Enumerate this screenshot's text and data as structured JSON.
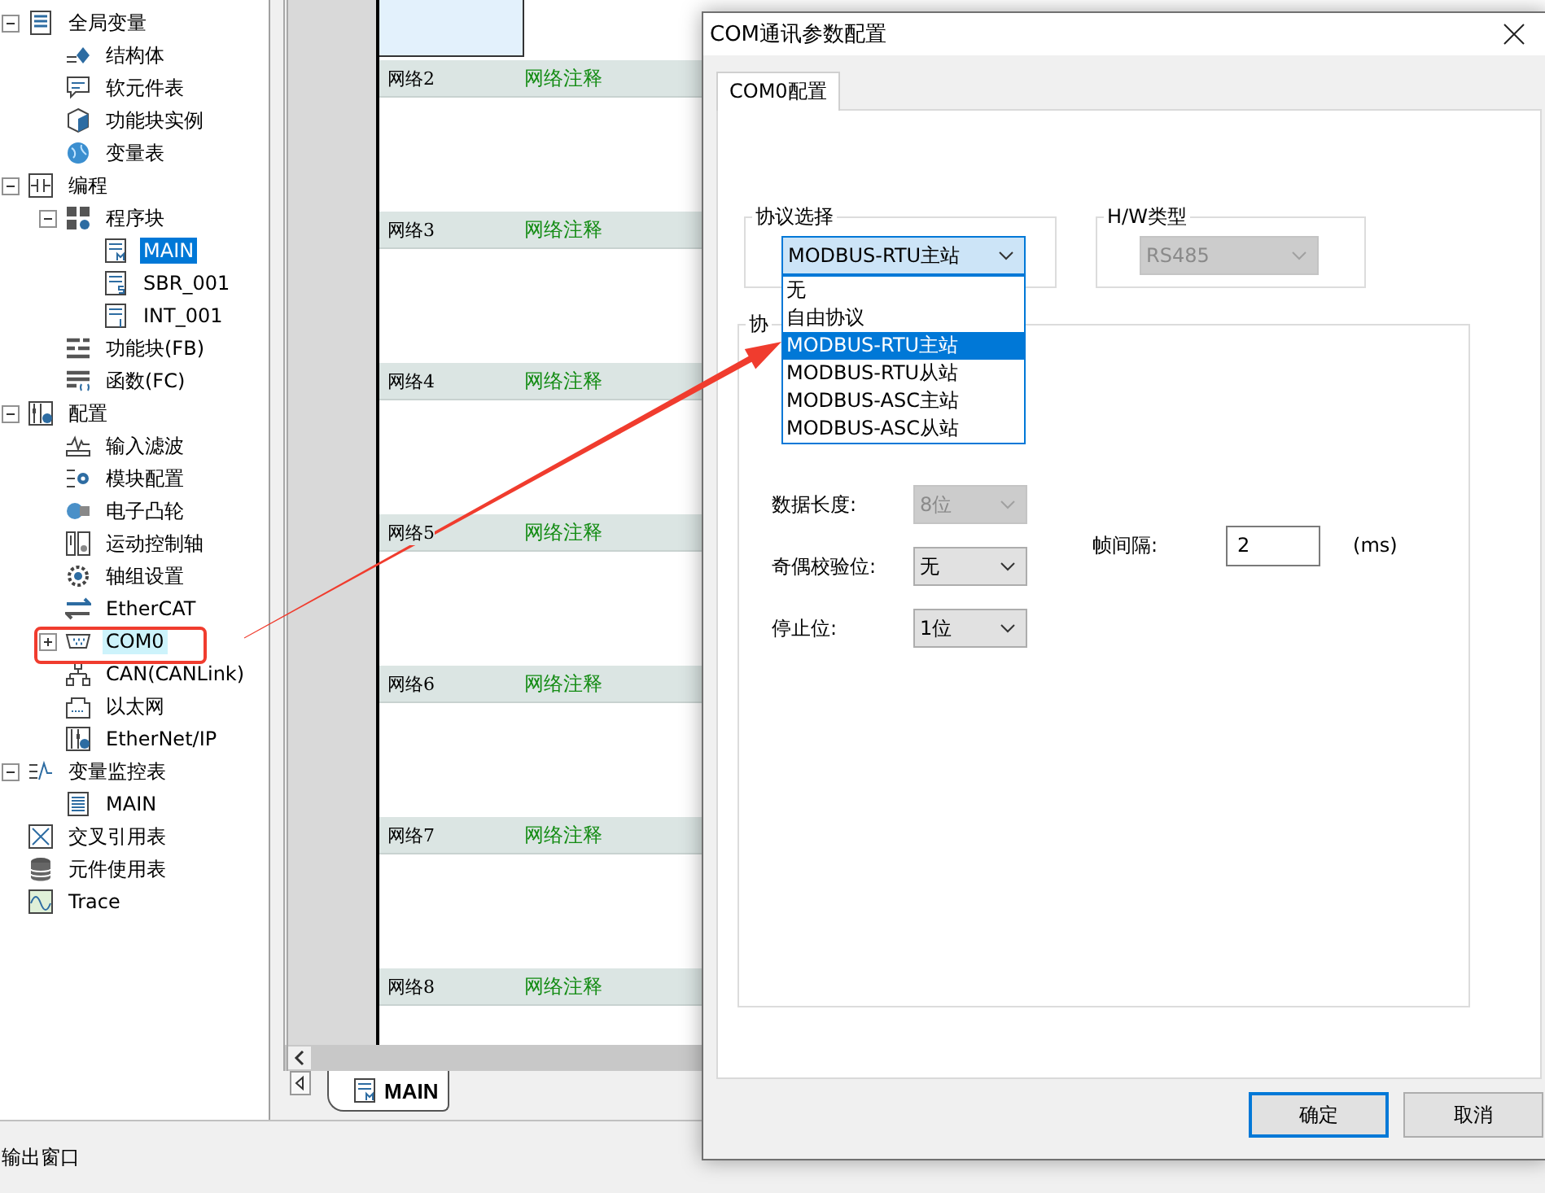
{
  "tree": [
    {
      "label": "全局变量",
      "expanded": true,
      "selected": false,
      "highlighted": false,
      "children": [
        {
          "label": "结构体",
          "selected": false,
          "highlighted": false
        },
        {
          "label": "软元件表",
          "selected": false,
          "highlighted": false
        },
        {
          "label": "功能块实例",
          "selected": false,
          "highlighted": false
        },
        {
          "label": "变量表",
          "selected": false,
          "highlighted": false
        }
      ]
    },
    {
      "label": "编程",
      "expanded": true,
      "selected": false,
      "highlighted": false,
      "children": [
        {
          "label": "程序块",
          "expanded": true,
          "selected": false,
          "highlighted": false,
          "children": [
            {
              "label": "MAIN",
              "selected": true,
              "highlighted": false
            },
            {
              "label": "SBR_001",
              "selected": false,
              "highlighted": false
            },
            {
              "label": "INT_001",
              "selected": false,
              "highlighted": false
            }
          ]
        },
        {
          "label": "功能块(FB)",
          "selected": false,
          "highlighted": false
        },
        {
          "label": "函数(FC)",
          "selected": false,
          "highlighted": false
        }
      ]
    },
    {
      "label": "配置",
      "expanded": true,
      "selected": false,
      "highlighted": false,
      "children": [
        {
          "label": "输入滤波",
          "selected": false,
          "highlighted": false
        },
        {
          "label": "模块配置",
          "selected": false,
          "highlighted": false
        },
        {
          "label": "电子凸轮",
          "selected": false,
          "highlighted": false
        },
        {
          "label": "运动控制轴",
          "selected": false,
          "highlighted": false
        },
        {
          "label": "轴组设置",
          "selected": false,
          "highlighted": false
        },
        {
          "label": "EtherCAT",
          "selected": false,
          "highlighted": false
        },
        {
          "label": "COM0",
          "expanded": false,
          "selected": false,
          "highlighted": true
        },
        {
          "label": "CAN(CANLink)",
          "selected": false,
          "highlighted": false
        },
        {
          "label": "以太网",
          "selected": false,
          "highlighted": false
        },
        {
          "label": "EtherNet/IP",
          "selected": false,
          "highlighted": false
        }
      ]
    },
    {
      "label": "变量监控表",
      "expanded": true,
      "selected": false,
      "highlighted": false,
      "children": [
        {
          "label": "MAIN",
          "selected": false,
          "highlighted": false
        }
      ]
    },
    {
      "label": "交叉引用表",
      "selected": false,
      "highlighted": false
    },
    {
      "label": "元件使用表",
      "selected": false,
      "highlighted": false
    },
    {
      "label": "Trace",
      "selected": false,
      "highlighted": false
    }
  ],
  "editor": {
    "networks": [
      {
        "label": "网络2",
        "comment": "网络注释"
      },
      {
        "label": "网络3",
        "comment": "网络注释"
      },
      {
        "label": "网络4",
        "comment": "网络注释"
      },
      {
        "label": "网络5",
        "comment": "网络注释"
      },
      {
        "label": "网络6",
        "comment": "网络注释"
      },
      {
        "label": "网络7",
        "comment": "网络注释"
      },
      {
        "label": "网络8",
        "comment": "网络注释"
      }
    ],
    "tabs": [
      {
        "label": "MAIN",
        "selected": true
      }
    ]
  },
  "output_window": {
    "title": "输出窗口"
  },
  "dialog": {
    "title": "COM通讯参数配置",
    "tabs": [
      {
        "label": "COM0配置",
        "selected": true
      }
    ],
    "protocol": {
      "label": "协议选择",
      "value": "MODBUS-RTU主站",
      "open": true,
      "options": [
        {
          "label": "无",
          "selected": false
        },
        {
          "label": "自由协议",
          "selected": false
        },
        {
          "label": "MODBUS-RTU主站",
          "selected": true
        },
        {
          "label": "MODBUS-RTU从站",
          "selected": false
        },
        {
          "label": "MODBUS-ASC主站",
          "selected": false
        },
        {
          "label": "MODBUS-ASC从站",
          "selected": false
        }
      ]
    },
    "hw_type": {
      "label": "H/W类型",
      "value": "RS485",
      "disabled": true
    },
    "params": {
      "label": "协",
      "fields": [
        {
          "label": "数据长度:",
          "value": "8位",
          "disabled": true
        },
        {
          "label": "奇偶校验位:",
          "value": "无",
          "disabled": false
        },
        {
          "label": "停止位:",
          "value": "1位",
          "disabled": false
        }
      ],
      "frame_interval": {
        "label": "帧间隔:",
        "value": "2",
        "unit": "(ms)"
      }
    },
    "buttons": [
      {
        "label": "确定",
        "default": true
      },
      {
        "label": "取消",
        "default": false
      }
    ]
  }
}
